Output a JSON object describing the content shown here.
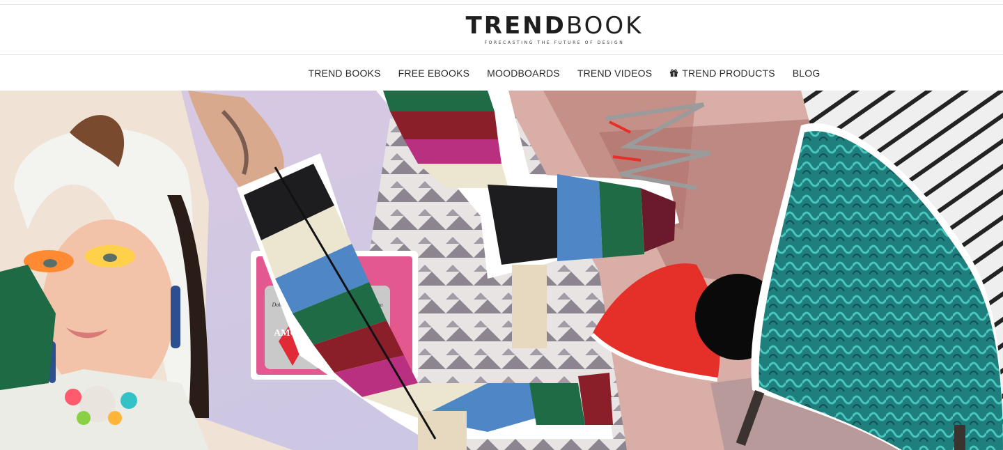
{
  "brand": {
    "logo_bold": "TREND",
    "logo_light": "BOOK",
    "tagline": "FORECASTING THE FUTURE OF DESIGN"
  },
  "nav": {
    "items": [
      {
        "label": "TREND BOOKS",
        "icon": null
      },
      {
        "label": "FREE EBOOKS",
        "icon": null
      },
      {
        "label": "MOODBOARDS",
        "icon": null
      },
      {
        "label": "TREND VIDEOS",
        "icon": null
      },
      {
        "label": "TREND PRODUCTS",
        "icon": "gift-icon"
      },
      {
        "label": "BLOG",
        "icon": null
      }
    ]
  },
  "hero": {
    "can_text": "AMORE",
    "can_brand": "Dolce & Gabbana",
    "colors": {
      "lavender": "#cfc4dc",
      "boot_black": "#1d1d1f",
      "boot_blue": "#4f86c6",
      "boot_green": "#1f6b45",
      "boot_red": "#8a1f2a",
      "boot_pink": "#b8307f",
      "boot_cream": "#ece5cf",
      "lamp_red": "#e5302a",
      "chair_teal": "#2a9a93",
      "rug_pink": "#d8aea6",
      "clutch_pink": "#e2588f"
    }
  }
}
